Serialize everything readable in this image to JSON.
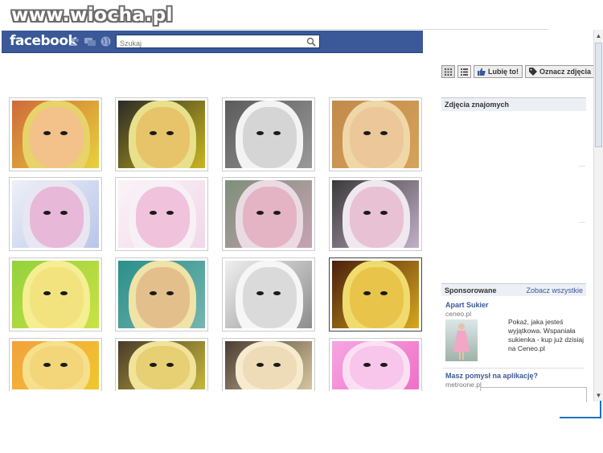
{
  "watermark": "www.wiocha.pl",
  "header": {
    "logo": "facebook",
    "search_placeholder": "Szukaj"
  },
  "toolbar": {
    "like_label": "Lubię to!",
    "tag_label": "Oznacz zdjęcia"
  },
  "sidebar": {
    "friends_photos_title": "Zdjęcia znajomych",
    "sponsored_title": "Sponsorowane",
    "see_all": "Zobacz wszystkie",
    "ads": [
      {
        "title": "Apart Sukier",
        "url": "ceneo.pl",
        "text": "Pokaż, jaka jesteś wyjątkowa. Wspaniała sukienka - kup już dzisiaj na Ceneo.pl"
      },
      {
        "title": "Masz pomysł na aplikację?",
        "url": "metroone.pl"
      }
    ]
  },
  "photos": [
    {
      "tint": "#e8d23a",
      "bg": "#cf6a3b",
      "face": "#f2c28a",
      "hair": "#e7d36a"
    },
    {
      "tint": "#c9b720",
      "bg": "#2c2a25",
      "face": "#e7c46a",
      "hair": "#e9e08c"
    },
    {
      "tint": "#9a9a9a",
      "bg": "#5b5b5b",
      "face": "#d5d5d5",
      "hair": "#f3f3f3"
    },
    {
      "tint": "#d6a35a",
      "bg": "#c28a4b",
      "face": "#ecc79a",
      "hair": "#f0d7a8"
    },
    {
      "tint": "#b8c6e9",
      "bg": "#eef0f8",
      "face": "#e8b8d8",
      "hair": "#e8e6f1"
    },
    {
      "tint": "#f1d7e9",
      "bg": "#fbf3f8",
      "face": "#f0c2dc",
      "hair": "#f7f0f5"
    },
    {
      "tint": "#c7a3b3",
      "bg": "#7e8f7a",
      "face": "#e4b4c4",
      "hair": "#eadbe2"
    },
    {
      "tint": "#c2b0c8",
      "bg": "#3a3a3a",
      "face": "#e8c1d4",
      "hair": "#efe8ee"
    },
    {
      "tint": "#c9e245",
      "bg": "#94d23c",
      "face": "#f3e37e",
      "hair": "#f5ee93"
    },
    {
      "tint": "#76b6b0",
      "bg": "#2a8f8a",
      "face": "#e3c08b",
      "hair": "#f0e3a8"
    },
    {
      "tint": "#8d8d8d",
      "bg": "#efefef",
      "face": "#dadada",
      "hair": "#f6f6f6"
    },
    {
      "tint": "#d8a81d",
      "bg": "#4a1f0e",
      "face": "#e9c44a",
      "hair": "#f0dc6e"
    },
    {
      "tint": "#f0c72c",
      "bg": "#f3a13d",
      "face": "#f3d57a",
      "hair": "#f6e08c"
    },
    {
      "tint": "#c6b83b",
      "bg": "#4a3b2b",
      "face": "#e7cf73",
      "hair": "#f0e39a"
    },
    {
      "tint": "#d6c69e",
      "bg": "#4b3d33",
      "face": "#eedcb8",
      "hair": "#f6ebcf"
    },
    {
      "tint": "#f070c8",
      "bg": "#f6a6e1",
      "face": "#f7c6ea",
      "hair": "#fbe0f3"
    }
  ]
}
